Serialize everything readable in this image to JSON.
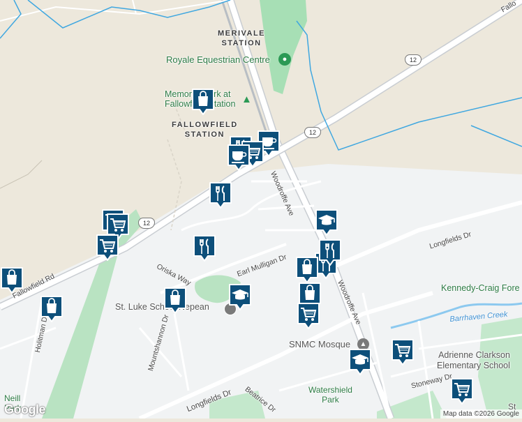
{
  "labels": {
    "merivale_station_1": "MERIVALE",
    "merivale_station_2": "STATION",
    "royale_equestrian": "Royale Equestrian Centre",
    "memorial_park_1": "Memorial Park at",
    "memorial_park_2": "Fallowfield Station",
    "fallowfield_station_1": "FALLOWFIELD",
    "fallowfield_station_2": "STATION",
    "woodroffe_ave_north": "Woodroffe Ave",
    "woodroffe_ave_south": "Woodroffe Ave",
    "fallowfield_rd": "Fallowfield Rd",
    "fallowfield_rd_ne": "Fallo",
    "oriska_way": "Oriska Way",
    "earl_mulligan_dr": "Earl Mulligan Dr",
    "longfields_dr_east": "Longfields Dr",
    "longfields_dr_south": "Longfields Dr",
    "kennedy_craig": "Kennedy-Craig Fore",
    "barrhaven_creek": "Barrhaven Creek",
    "st_luke_school": "St. Luke School Nepean",
    "holitman_dr": "Holitman Dr",
    "mountshannon_dr": "Mountshannon Dr",
    "snmc_mosque": "SNMC Mosque",
    "adrienne_clarkson_1": "Adrienne Clarkson",
    "adrienne_clarkson_2": "Elementary School",
    "stoneway_dr": "Stoneway Dr",
    "watershield_park_1": "Watershield",
    "watershield_park_2": "Park",
    "beatrice_dr": "Beatrice Dr",
    "neill_1": "Neill",
    "neill_2": "Park",
    "st_partial": "St"
  },
  "shields": {
    "route12_a": "12",
    "route12_b": "12",
    "route12_c": "12"
  },
  "attribution": "Map data ©2026 Google",
  "logo": "Google",
  "colors": {
    "marker": "#0d4f7a",
    "boundary": "#3fa7e0",
    "park": "#9fdcae",
    "land": "#ede8dc",
    "residential": "#f1f3f4"
  },
  "markers": [
    {
      "icon": "shopping-bag-icon"
    },
    {
      "icon": "coffee-icon"
    },
    {
      "icon": "restaurant-icon"
    },
    {
      "icon": "cart-icon"
    },
    {
      "icon": "coffee-icon"
    },
    {
      "icon": "restaurant-icon"
    },
    {
      "icon": "restaurant-icon"
    },
    {
      "icon": "cart-icon"
    },
    {
      "icon": "cart-icon"
    },
    {
      "icon": "cart-icon"
    },
    {
      "icon": "shopping-bag-icon"
    },
    {
      "icon": "shopping-bag-icon"
    },
    {
      "icon": "restaurant-icon"
    },
    {
      "icon": "school-icon"
    },
    {
      "icon": "shopping-bag-icon"
    },
    {
      "icon": "school-icon"
    },
    {
      "icon": "restaurant-icon"
    },
    {
      "icon": "shopping-bag-icon"
    },
    {
      "icon": "shopping-bag-icon"
    },
    {
      "icon": "cart-icon"
    },
    {
      "icon": "school-icon"
    },
    {
      "icon": "cart-icon"
    },
    {
      "icon": "cart-icon"
    }
  ]
}
